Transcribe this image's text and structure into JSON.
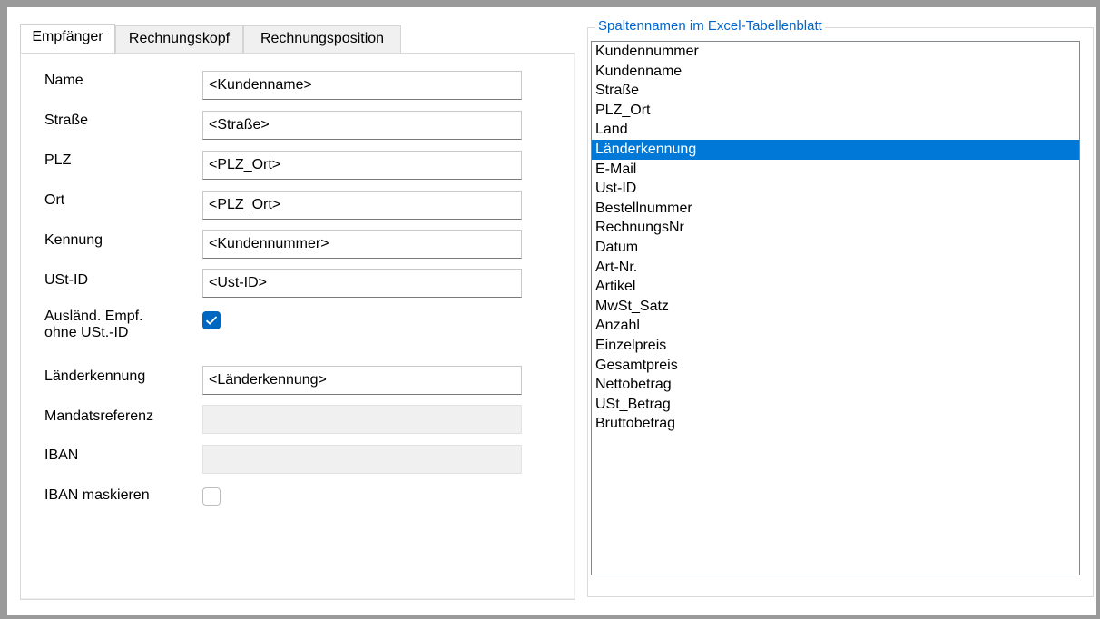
{
  "tabs": [
    "Empfänger",
    "Rechnungskopf",
    "Rechnungsposition"
  ],
  "form": {
    "name_label": "Name",
    "name_value": "<Kundenname>",
    "strasse_label": "Straße",
    "strasse_value": "<Straße>",
    "plz_label": "PLZ",
    "plz_value": "<PLZ_Ort>",
    "ort_label": "Ort",
    "ort_value": "<PLZ_Ort>",
    "kennung_label": "Kennung",
    "kennung_value": "<Kundennummer>",
    "ustid_label": "USt-ID",
    "ustid_value": "<Ust-ID>",
    "auslaend_label_line1": "Ausländ.  Empf.",
    "auslaend_label_line2": "ohne USt.-ID",
    "auslaend_checked": true,
    "laenderkennung_label": "Länderkennung",
    "laenderkennung_value": "<Länderkennung>",
    "mandatsreferenz_label": "Mandatsreferenz",
    "mandatsreferenz_value": "",
    "iban_label": "IBAN",
    "iban_value": "",
    "iban_maskieren_label": "IBAN maskieren",
    "iban_maskieren_checked": false
  },
  "columns_group": {
    "title": "Spaltennamen im Excel-Tabellenblatt",
    "selected": "Länderkennung",
    "items": [
      "Kundennummer",
      "Kundenname",
      "Straße",
      "PLZ_Ort",
      "Land",
      "Länderkennung",
      "E-Mail",
      "Ust-ID",
      "Bestellnummer",
      "RechnungsNr",
      "Datum",
      "Art-Nr.",
      "Artikel",
      "MwSt_Satz",
      "Anzahl",
      "Einzelpreis",
      "Gesamtpreis",
      "Nettobetrag",
      "USt_Betrag",
      "Bruttobetrag"
    ]
  },
  "colors": {
    "accent": "#0078d7",
    "group_title": "#0066cc",
    "frame": "#9a9a9a"
  }
}
